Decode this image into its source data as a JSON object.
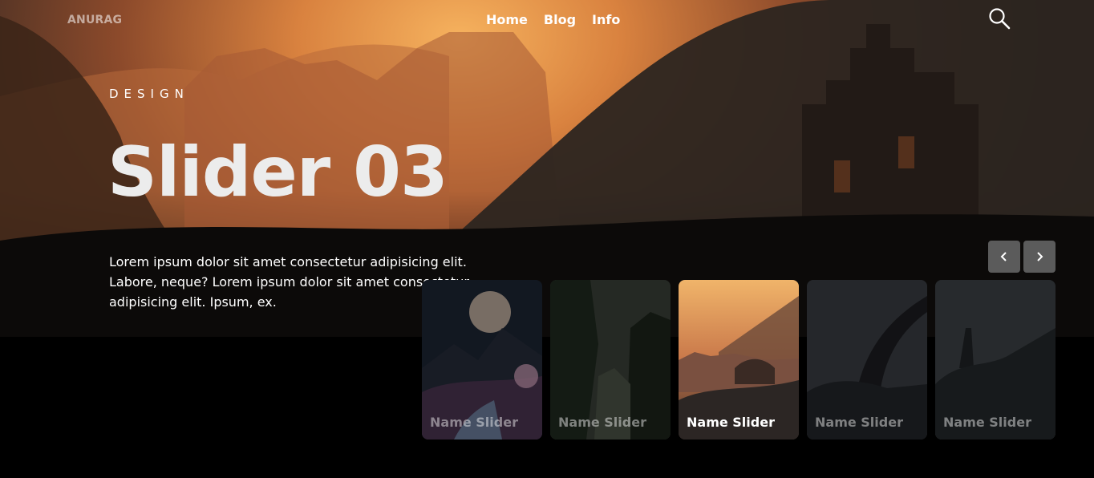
{
  "brand": {
    "logo": "ANURAG"
  },
  "nav": {
    "items": [
      "Home",
      "Blog",
      "Info"
    ]
  },
  "hero": {
    "eyebrow": "DESIGN",
    "title": "Slider 03",
    "description": "Lorem ipsum dolor sit amet consectetur adipisicing elit. Labore, neque? Lorem ipsum dolor sit amet consectetur adipisicing elit. Ipsum, ex."
  },
  "controls": {
    "prev_icon": "chevron-left-icon",
    "next_icon": "chevron-right-icon",
    "search_icon": "search-icon"
  },
  "slides": [
    {
      "label": "Name Slider",
      "active": false
    },
    {
      "label": "Name Slider",
      "active": false
    },
    {
      "label": "Name Slider",
      "active": true
    },
    {
      "label": "Name Slider",
      "active": false
    },
    {
      "label": "Name Slider",
      "active": false
    }
  ],
  "colors": {
    "accent": "#f6b25e",
    "button_bg": "#5b5b5b",
    "background": "#000000"
  }
}
